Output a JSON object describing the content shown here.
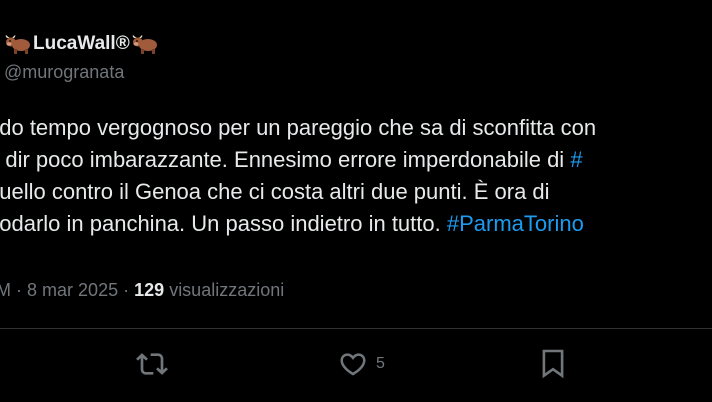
{
  "author": {
    "display_name": "LucaWall®",
    "handle": "@murogranata",
    "name_emoji": "ox-emoji"
  },
  "tweet": {
    "lines": [
      {
        "text": "ndo tempo vergognoso per un pareggio che sa di sconfitta con",
        "hashtag": ""
      },
      {
        "text": "a dir poco imbarazzante. Ennesimo errore imperdonabile di ",
        "hashtag": "#"
      },
      {
        "text": "quello contro il Genoa che ci costa altri due punti. È ora di",
        "hashtag": ""
      },
      {
        "text": "nodarlo in panchina. Un passo indietro in tutto. ",
        "hashtag": "#ParmaTorino"
      }
    ]
  },
  "meta": {
    "time_fragment": "M",
    "separator": "·",
    "date": "8 mar 2025",
    "views_count": "129",
    "views_label": "visualizzazioni"
  },
  "actions": {
    "retweet_icon": "retweet-icon",
    "like_icon": "heart-icon",
    "like_count": "5",
    "bookmark_icon": "bookmark-icon"
  },
  "colors": {
    "background": "#000000",
    "text": "#e7e9ea",
    "secondary": "#71767b",
    "hashtag": "#1d9bf0",
    "divider": "#2f3336"
  }
}
